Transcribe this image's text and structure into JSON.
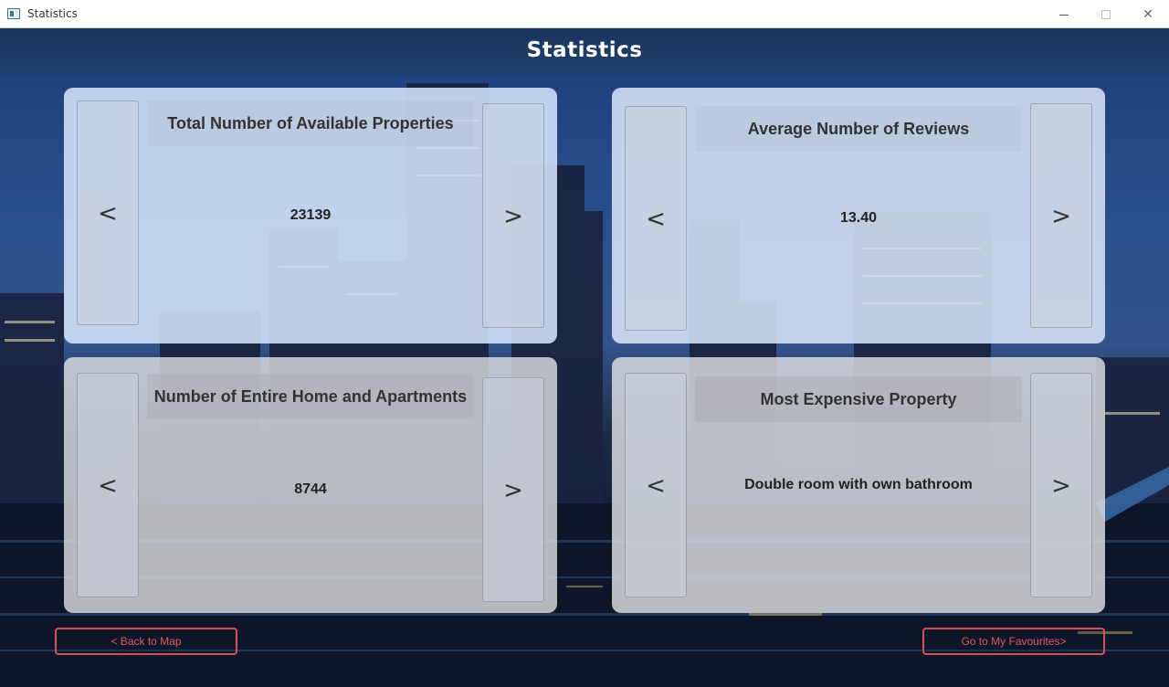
{
  "window": {
    "title": "Statistics",
    "minimize_icon": "minimize-icon",
    "maximize_icon": "maximize-icon",
    "close_icon": "close-icon",
    "close_glyph": "✕"
  },
  "header": {
    "title": "Statistics"
  },
  "cards": [
    {
      "title": "Total Number of Available Properties",
      "value": "23139",
      "prev": "<",
      "next": ">"
    },
    {
      "title": "Average Number of Reviews",
      "value": "13.40",
      "prev": "<",
      "next": ">"
    },
    {
      "title": "Number of Entire Home and Apartments",
      "value": "8744",
      "prev": "<",
      "next": ">"
    },
    {
      "title": "Most Expensive Property",
      "value": "Double room with own bathroom",
      "prev": "<",
      "next": ">"
    }
  ],
  "footer": {
    "back_label": "< Back to Map",
    "favourites_label": "Go to My Favourites>"
  },
  "colors": {
    "header_bg": "#1e3e6c",
    "footer_button_border": "#d9505a",
    "footer_button_text": "#e05a64"
  }
}
